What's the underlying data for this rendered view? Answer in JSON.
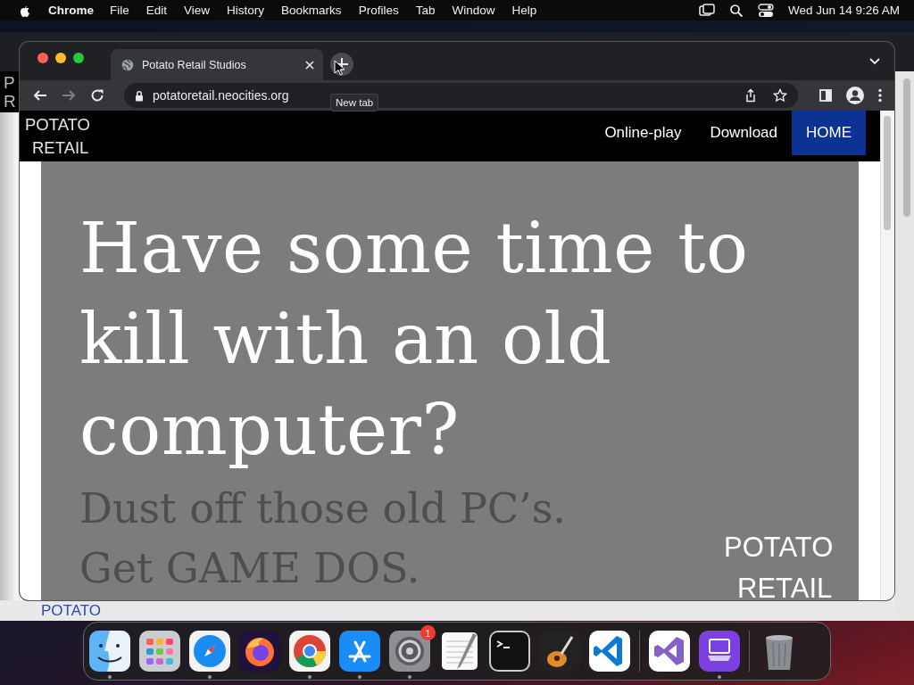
{
  "menu_bar": {
    "app_name": "Chrome",
    "menus": [
      "File",
      "Edit",
      "View",
      "History",
      "Bookmarks",
      "Profiles",
      "Tab",
      "Window",
      "Help"
    ],
    "clock": "Wed Jun 14  9:26 AM"
  },
  "background_window": {
    "edge_texts": [
      "P",
      "R"
    ],
    "bottom_text": "POTATO"
  },
  "browser": {
    "tabs": [
      {
        "title": "Potato Retail Studios",
        "selected": true
      }
    ],
    "tooltip": "New tab",
    "url": "potatoretail.neocities.org"
  },
  "site": {
    "logo": [
      "POTATO",
      "RETAIL"
    ],
    "nav": [
      {
        "label": "Online-play",
        "selected": false
      },
      {
        "label": "Download",
        "selected": false
      },
      {
        "label": "HOME",
        "selected": true
      }
    ],
    "hero": {
      "headline": "Have some time to kill with an old computer?",
      "subtext": [
        "Dust off those old PC’s.",
        "Get GAME DOS."
      ],
      "logo": [
        "POTATO",
        "RETAIL"
      ]
    }
  },
  "dock": {
    "items": [
      {
        "kind": "finder",
        "running": true
      },
      {
        "kind": "launchpad",
        "running": false
      },
      {
        "kind": "safari",
        "running": true
      },
      {
        "kind": "firefox",
        "running": false
      },
      {
        "kind": "chrome",
        "running": true
      },
      {
        "kind": "appstore",
        "running": true
      },
      {
        "kind": "settings",
        "running": true,
        "badge": "1"
      },
      {
        "kind": "textedit",
        "running": false
      },
      {
        "kind": "terminal",
        "running": false
      },
      {
        "kind": "garageband",
        "running": false
      },
      {
        "kind": "vscode",
        "running": false
      },
      {
        "kind": "separator"
      },
      {
        "kind": "visualstudio",
        "running": false
      },
      {
        "kind": "configurator",
        "running": true
      },
      {
        "kind": "separator"
      },
      {
        "kind": "trash",
        "running": false
      }
    ]
  }
}
